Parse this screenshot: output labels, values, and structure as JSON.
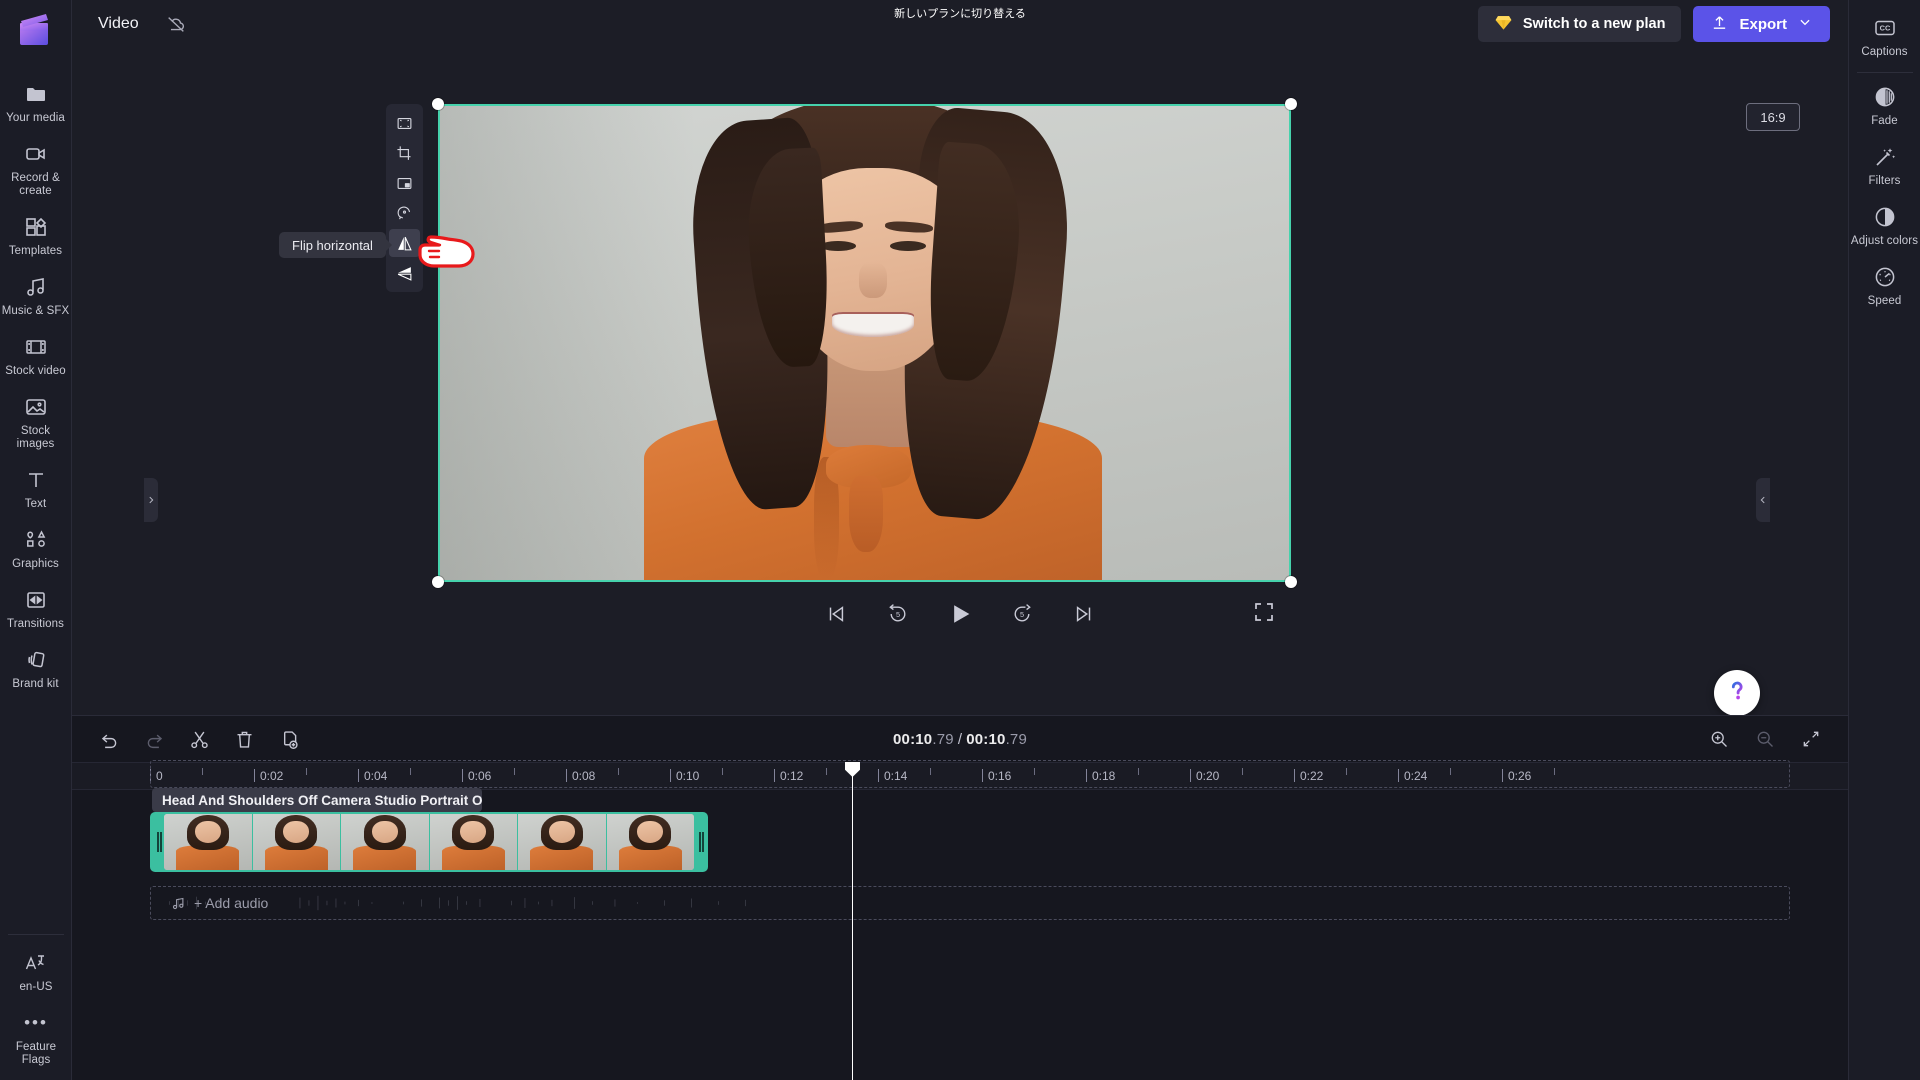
{
  "left_sidebar": {
    "logo_name": "clipchamp-logo",
    "items": [
      {
        "label": "Your media",
        "icon": "folder-icon"
      },
      {
        "label": "Record & create",
        "icon": "video-camera-icon"
      },
      {
        "label": "Templates",
        "icon": "templates-icon"
      },
      {
        "label": "Music & SFX",
        "icon": "music-note-icon"
      },
      {
        "label": "Stock video",
        "icon": "film-strip-icon"
      },
      {
        "label": "Stock images",
        "icon": "image-icon"
      },
      {
        "label": "Text",
        "icon": "text-icon"
      },
      {
        "label": "Graphics",
        "icon": "shapes-icon"
      },
      {
        "label": "Transitions",
        "icon": "transitions-icon"
      },
      {
        "label": "Brand kit",
        "icon": "brand-kit-icon"
      }
    ],
    "bottom_items": [
      {
        "label": "en-US",
        "icon": "language-icon"
      },
      {
        "label": "Feature Flags",
        "icon": "more-dots-icon"
      }
    ]
  },
  "header": {
    "project_title": "Video",
    "sync_status_icon": "cloud-off-icon",
    "plan_banner_text": "新しいプランに切り替える",
    "switch_plan_label": "Switch to a new plan",
    "switch_plan_icon": "diamond-icon",
    "export_label": "Export",
    "export_icon": "upload-icon",
    "export_chevron_icon": "chevron-down-icon",
    "captions_label": "Captions",
    "captions_icon": "cc-icon"
  },
  "preview": {
    "aspect_ratio": "16:9",
    "selection_color": "#46d2ac",
    "tooltip_text": "Flip horizontal",
    "tool_rail": [
      {
        "name": "fit-to-frame-tool",
        "icon": "fit-frame-icon",
        "active": false
      },
      {
        "name": "crop-tool",
        "icon": "crop-icon",
        "active": false
      },
      {
        "name": "picture-in-picture-tool",
        "icon": "pip-icon",
        "active": false
      },
      {
        "name": "rotate-tool",
        "icon": "rotate-icon",
        "active": false
      },
      {
        "name": "flip-horizontal-tool",
        "icon": "flip-horizontal-icon",
        "active": true
      },
      {
        "name": "flip-vertical-tool",
        "icon": "flip-vertical-icon",
        "active": false
      }
    ],
    "playback": [
      {
        "name": "skip-to-start-button",
        "icon": "skip-start-icon"
      },
      {
        "name": "rewind-5-button",
        "icon": "rewind-5-icon"
      },
      {
        "name": "play-button",
        "icon": "play-icon"
      },
      {
        "name": "forward-5-button",
        "icon": "forward-5-icon"
      },
      {
        "name": "skip-to-end-button",
        "icon": "skip-end-icon"
      }
    ],
    "fullscreen_icon": "fullscreen-icon",
    "help_icon": "question-mark-icon"
  },
  "right_sidebar": {
    "items": [
      {
        "label": "Fade",
        "icon": "fade-icon"
      },
      {
        "label": "Filters",
        "icon": "magic-wand-icon"
      },
      {
        "label": "Adjust colors",
        "icon": "contrast-icon"
      },
      {
        "label": "Speed",
        "icon": "speedometer-icon"
      }
    ]
  },
  "timeline": {
    "toolbar": [
      {
        "name": "undo-button",
        "icon": "undo-icon",
        "disabled": false
      },
      {
        "name": "redo-button",
        "icon": "redo-icon",
        "disabled": true
      },
      {
        "name": "split-button",
        "icon": "scissors-icon",
        "disabled": false
      },
      {
        "name": "delete-button",
        "icon": "trash-icon",
        "disabled": false
      },
      {
        "name": "duplicate-button",
        "icon": "duplicate-icon",
        "disabled": false
      }
    ],
    "current_time": "00:10",
    "current_time_frac": ".79",
    "total_time": "00:10",
    "total_time_frac": ".79",
    "time_separator": "/",
    "zoom_in_icon": "zoom-in-icon",
    "zoom_out_icon": "zoom-out-icon",
    "fit_timeline_icon": "fit-timeline-icon",
    "ruler_labels": [
      "0",
      "0:02",
      "0:04",
      "0:06",
      "0:08",
      "0:10",
      "0:12",
      "0:14",
      "0:16",
      "0:18",
      "0:20",
      "0:22",
      "0:24",
      "0:26"
    ],
    "clip_title": "Head And Shoulders Off Camera Studio Portrait Of Smili...",
    "clip_color": "#3bbfa0",
    "clip_thumbnail_count": 6,
    "add_audio_label": "+ Add audio",
    "add_audio_icon": "music-note-icon",
    "playhead_time": "00:10.79"
  }
}
